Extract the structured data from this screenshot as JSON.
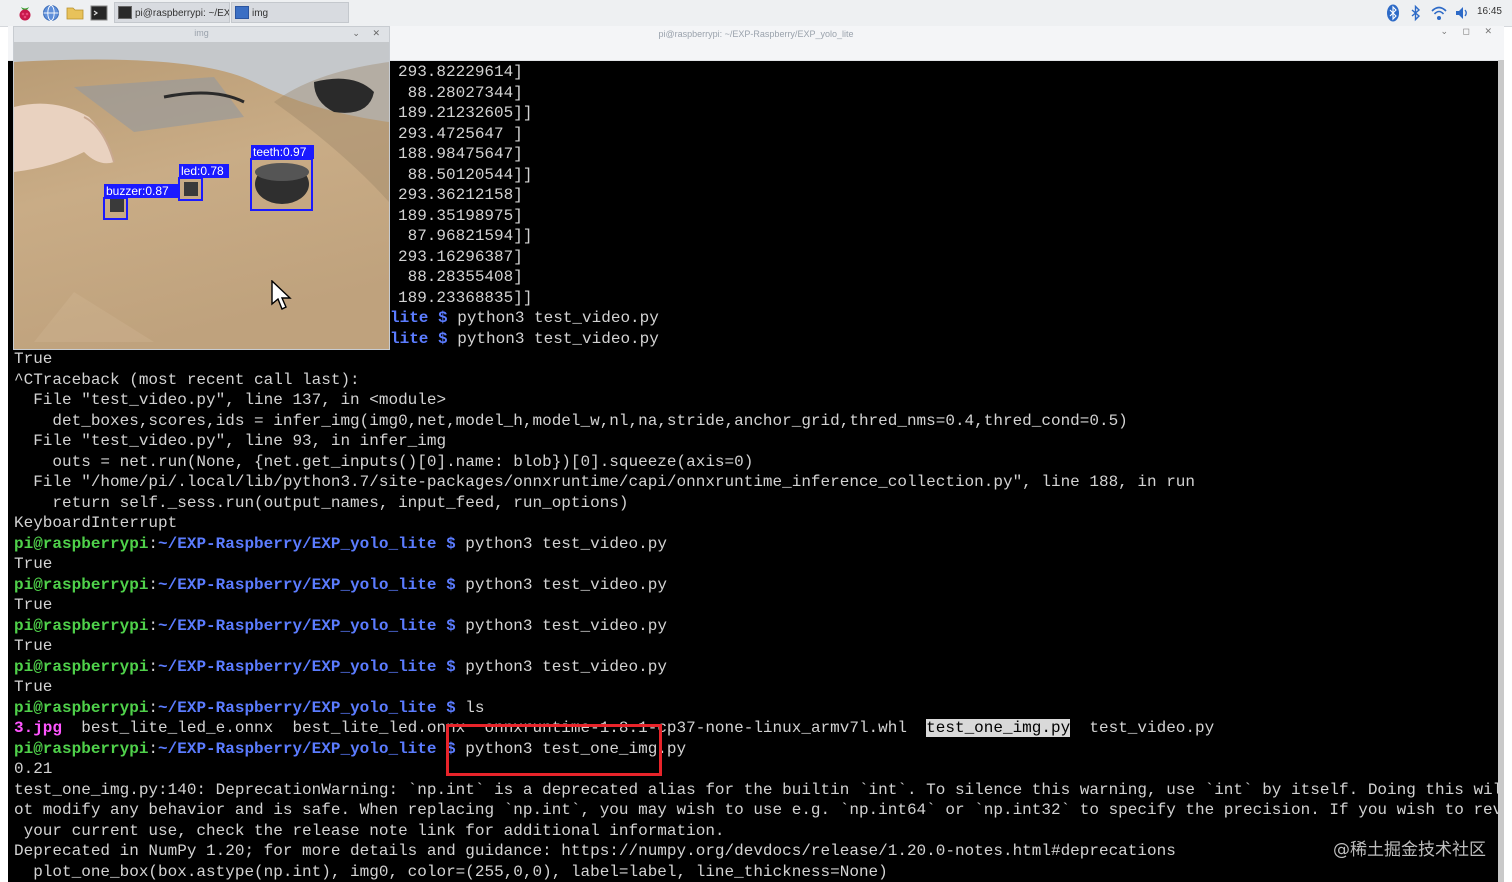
{
  "taskbar": {
    "terminal_task_label": "pi@raspberrypi: ~/EX...",
    "img_task_label": "img",
    "clock": "16:45",
    "icons": [
      "raspberry-menu-icon",
      "browser-globe-icon",
      "file-manager-icon",
      "terminal-icon",
      "bluetooth-icon",
      "bluetooth-icon",
      "wifi-icon",
      "volume-icon"
    ]
  },
  "terminal": {
    "title": "pi@raspberrypi: ~/EXP-Raspberry/EXP_yolo_lite",
    "controls": "⌄ ◻ ✕",
    "top_lines": [
      "293.82229614]",
      " 88.28027344]",
      "189.21232605]]",
      "293.4725647 ]",
      "188.98475647]",
      " 88.50120544]]",
      "293.36212158]",
      "189.35198975]",
      " 87.96821594]]",
      "293.16296387]",
      " 88.28355408]",
      "189.23368835]]"
    ],
    "partial_prompt": "lite $",
    "partial_cmd": " python3 test_video.py",
    "traceback_lines": [
      "True",
      "^CTraceback (most recent call last):",
      "  File \"test_video.py\", line 137, in <module>",
      "    det_boxes,scores,ids = infer_img(img0,net,model_h,model_w,nl,na,stride,anchor_grid,thred_nms=0.4,thred_cond=0.5)",
      "  File \"test_video.py\", line 93, in infer_img",
      "    outs = net.run(None, {net.get_inputs()[0].name: blob})[0].squeeze(axis=0)",
      "  File \"/home/pi/.local/lib/python3.7/site-packages/onnxruntime/capi/onnxruntime_inference_collection.py\", line 188, in run",
      "    return self._sess.run(output_names, input_feed, run_options)",
      "KeyboardInterrupt"
    ],
    "prompt_user": "pi@raspberrypi",
    "prompt_colon": ":",
    "prompt_path": "~/EXP-Raspberry/EXP_yolo_lite $",
    "cmd_video": " python3 test_video.py",
    "true": "True",
    "cmd_ls": " ls",
    "ls_jpg": "3.jpg",
    "ls_rest": "  best_lite_led_e.onnx  best_lite_led.onnx  onnxruntime-1.8.1-cp37-none-linux_armv7l.whl  ",
    "ls_highlight": "test_one_img.py",
    "ls_last": "  test_video.py",
    "cmd_one": " python3 test_one_img.py",
    "output_lines": [
      "0.21",
      "test_one_img.py:140: DeprecationWarning: `np.int` is a deprecated alias for the builtin `int`. To silence this warning, use `int` by itself. Doing this will n",
      "ot modify any behavior and is safe. When replacing `np.int`, you may wish to use e.g. `np.int64` or `np.int32` to specify the precision. If you wish to review",
      " your current use, check the release note link for additional information.",
      "Deprecated in NumPy 1.20; for more details and guidance: https://numpy.org/devdocs/release/1.20.0-notes.html#deprecations",
      "  plot_one_box(box.astype(np.int), img0, color=(255,0,0), label=label, line_thickness=None)"
    ]
  },
  "img_window": {
    "title": "img",
    "controls": "⌄ ✕",
    "detections": [
      {
        "label": "teeth:0.97"
      },
      {
        "label": "led:0.78"
      },
      {
        "label": "buzzer:0.87"
      }
    ],
    "box_color": "#1a1aff"
  },
  "watermark": "@稀土掘金技术社区"
}
